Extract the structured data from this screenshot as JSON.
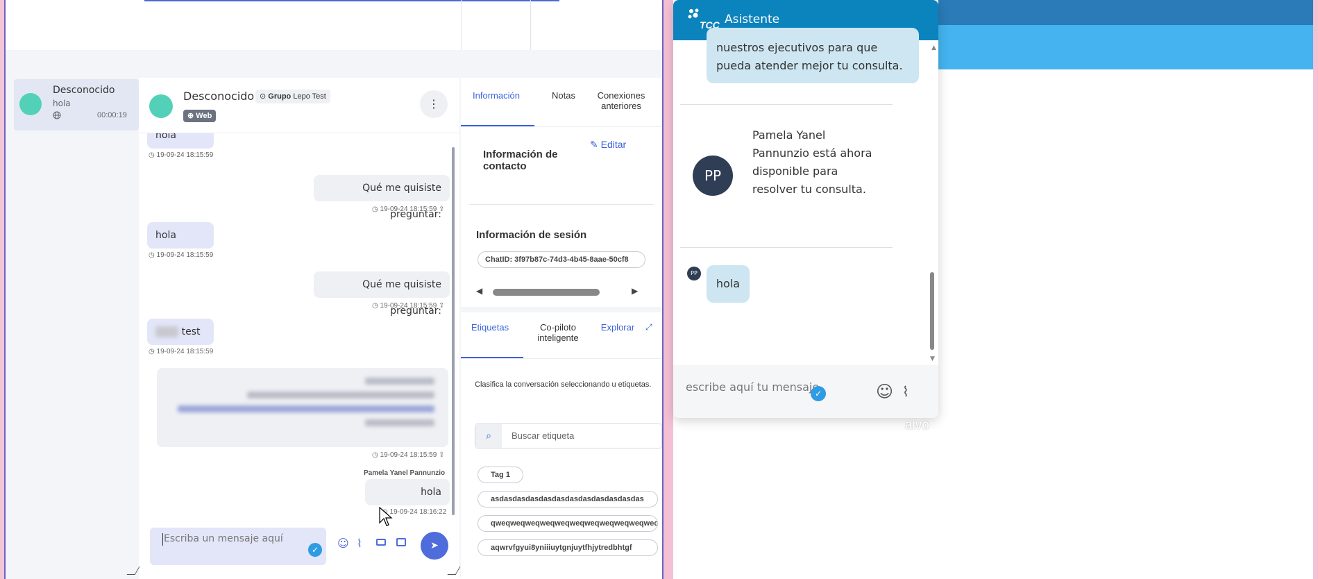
{
  "conversation_list": {
    "items": [
      {
        "name": "Desconocido",
        "preview": "hola",
        "time": "00:00:19"
      }
    ]
  },
  "chat": {
    "header": {
      "name": "Desconocido",
      "group_prefix": "Grupo",
      "group_name": "Lepo Test",
      "channel": "Web",
      "menu_icon": "kebab-vertical-icon"
    },
    "messages": [
      {
        "dir": "in",
        "text": "hola",
        "time": "19-09-24 18:15:59"
      },
      {
        "dir": "out",
        "text": "Qué me quisiste preguntar:",
        "time": "19-09-24 18:15:59"
      },
      {
        "dir": "in",
        "text": "hola",
        "time": "19-09-24 18:15:59"
      },
      {
        "dir": "out",
        "text": "Qué me quisiste preguntar:",
        "time": "19-09-24 18:15:59"
      },
      {
        "dir": "in",
        "text": "test",
        "time": "19-09-24 18:15:59"
      },
      {
        "dir": "out",
        "text": "",
        "time": "19-09-24 18:15:59"
      },
      {
        "dir": "out",
        "sender": "Pamela Yanel Pannunzio",
        "text": "hola",
        "time": "19-09-24 18:16:22"
      }
    ],
    "composer": {
      "placeholder": "Escriba un mensaje aquí"
    }
  },
  "info": {
    "tabs": [
      "Información",
      "Notas",
      "Conexiones anteriores"
    ],
    "contact_title": "Información de contacto",
    "edit_label": "Editar",
    "session_title": "Información de sesión",
    "chat_id": "ChatID: 3f97b87c-74d3-4b45-8aae-50cf8",
    "lower_tabs": [
      "Etiquetas",
      "Co-piloto inteligente",
      "Explorar"
    ],
    "classify_text": "Clasifica la conversación seleccionando u etiquetas.",
    "search_placeholder": "Buscar etiqueta",
    "tags": [
      "Tag 1",
      "asdasdasdasdasdasdasdasdasdasdasdas",
      "qweqweqweqweqweqweqweqweqweqweqweq",
      "aqwrvfgyui8yniiiuytgnjuytfhjytredbhtgf"
    ]
  },
  "widget": {
    "title": "Asistente",
    "brand": "TCC",
    "bot_message": "nuestros ejecutivos para que pueda atender mejor tu consulta.",
    "agent_initials": "PP",
    "agent_message": "Pamela Yanel Pannunzio está ahora disponible para resolver tu consulta.",
    "user_message": "hola",
    "input_placeholder": "escribe aquí tu mensaje",
    "footer_brand": "aivo"
  },
  "colors": {
    "accent": "#3a63d8",
    "send_button": "#4e6cdb",
    "widget_header": "#0b83bd",
    "teal_avatar": "#52d1b8"
  }
}
